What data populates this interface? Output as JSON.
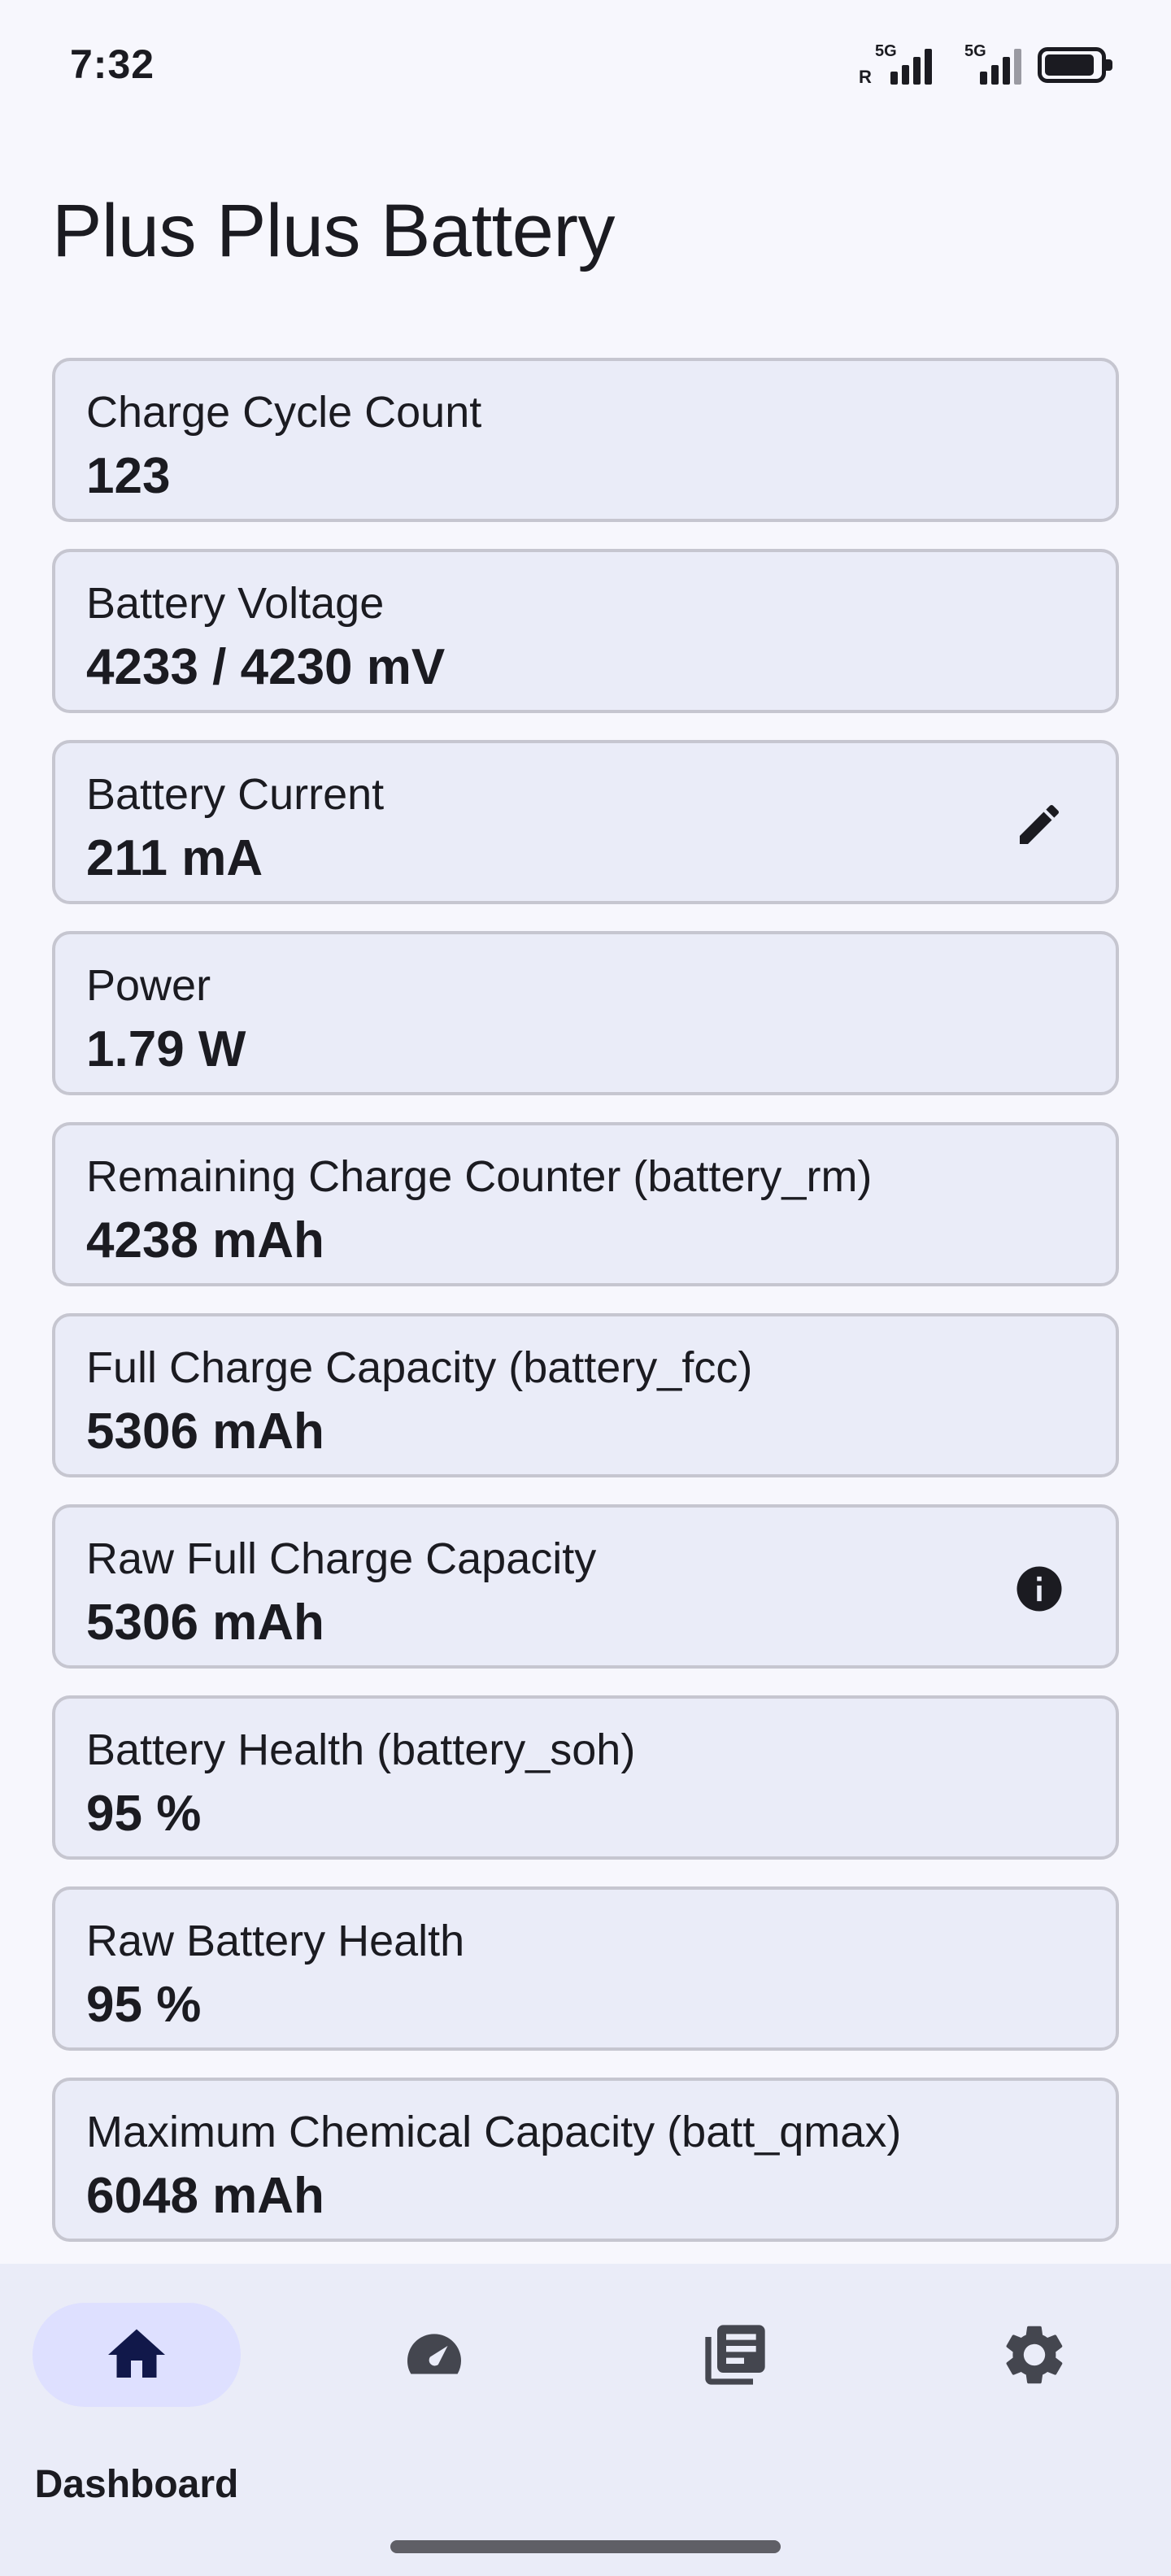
{
  "status_bar": {
    "time": "7:32",
    "sim1_network": "5G",
    "sim1_roaming": "R",
    "sim2_network": "5G",
    "icons": [
      "signal-icon",
      "signal-icon",
      "battery-icon"
    ]
  },
  "app": {
    "title": "Plus Plus Battery"
  },
  "cards": [
    {
      "label": "Charge Cycle Count",
      "value": "123"
    },
    {
      "label": "Battery Voltage",
      "value": "4233 / 4230 mV"
    },
    {
      "label": "Battery Current",
      "value": "211 mA",
      "icon": "edit-icon"
    },
    {
      "label": "Power",
      "value": "1.79 W"
    },
    {
      "label": "Remaining Charge Counter (battery_rm)",
      "value": "4238 mAh"
    },
    {
      "label": "Full Charge Capacity (battery_fcc)",
      "value": "5306 mAh"
    },
    {
      "label": "Raw Full Charge Capacity",
      "value": "5306 mAh",
      "icon": "info-icon"
    },
    {
      "label": "Battery Health (battery_soh)",
      "value": "95 %"
    },
    {
      "label": "Raw Battery Health",
      "value": "95 %"
    },
    {
      "label": "Maximum Chemical Capacity (batt_qmax)",
      "value": "6048 mAh"
    }
  ],
  "bottom_nav": {
    "items": [
      {
        "label": "Dashboard",
        "icon": "home-icon",
        "active": true
      },
      {
        "icon": "speedometer-icon"
      },
      {
        "icon": "history-icon"
      },
      {
        "icon": "settings-icon"
      }
    ]
  },
  "colors": {
    "background": "#f7f7fd",
    "card_background": "#eaecf8",
    "card_border": "#c6c6d0",
    "nav_background": "#eaecf8",
    "active_indicator": "#dee0ff",
    "text_primary": "#1b1b21",
    "icon_active": "#11184a",
    "icon_inactive": "#44464f"
  }
}
